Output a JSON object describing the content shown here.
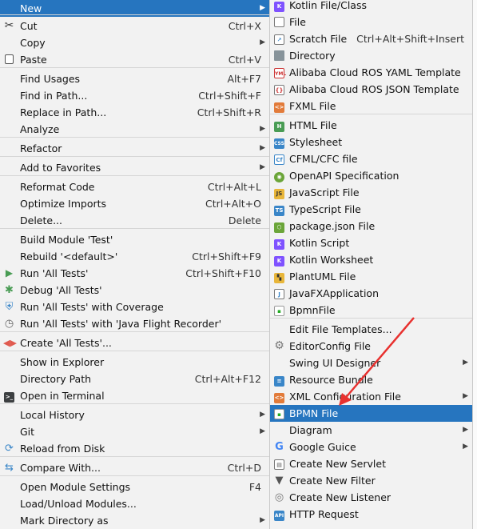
{
  "left_menu": {
    "items": [
      {
        "label": "New",
        "shortcut": "",
        "submenu": true,
        "icon": "",
        "selected": true
      },
      {
        "label": "Cut",
        "shortcut": "Ctrl+X",
        "submenu": false,
        "icon": "scissors-icon"
      },
      {
        "label": "Copy",
        "shortcut": "",
        "submenu": true,
        "icon": ""
      },
      {
        "label": "Paste",
        "shortcut": "Ctrl+V",
        "submenu": false,
        "icon": "clipboard-icon"
      },
      {
        "label": "Find Usages",
        "shortcut": "Alt+F7",
        "submenu": false,
        "icon": ""
      },
      {
        "label": "Find in Path...",
        "shortcut": "Ctrl+Shift+F",
        "submenu": false,
        "icon": ""
      },
      {
        "label": "Replace in Path...",
        "shortcut": "Ctrl+Shift+R",
        "submenu": false,
        "icon": ""
      },
      {
        "label": "Analyze",
        "shortcut": "",
        "submenu": true,
        "icon": ""
      },
      {
        "label": "Refactor",
        "shortcut": "",
        "submenu": true,
        "icon": ""
      },
      {
        "label": "Add to Favorites",
        "shortcut": "",
        "submenu": true,
        "icon": ""
      },
      {
        "label": "Reformat Code",
        "shortcut": "Ctrl+Alt+L",
        "submenu": false,
        "icon": ""
      },
      {
        "label": "Optimize Imports",
        "shortcut": "Ctrl+Alt+O",
        "submenu": false,
        "icon": ""
      },
      {
        "label": "Delete...",
        "shortcut": "Delete",
        "submenu": false,
        "icon": ""
      },
      {
        "label": "Build Module 'Test'",
        "shortcut": "",
        "submenu": false,
        "icon": ""
      },
      {
        "label": "Rebuild '<default>'",
        "shortcut": "Ctrl+Shift+F9",
        "submenu": false,
        "icon": ""
      },
      {
        "label": "Run 'All Tests'",
        "shortcut": "Ctrl+Shift+F10",
        "submenu": false,
        "icon": "run-icon"
      },
      {
        "label": "Debug 'All Tests'",
        "shortcut": "",
        "submenu": false,
        "icon": "debug-icon"
      },
      {
        "label": "Run 'All Tests' with Coverage",
        "shortcut": "",
        "submenu": false,
        "icon": "coverage-icon"
      },
      {
        "label": "Run 'All Tests' with 'Java Flight Recorder'",
        "shortcut": "",
        "submenu": false,
        "icon": "profiler-icon"
      },
      {
        "label": "Create 'All Tests'...",
        "shortcut": "",
        "submenu": false,
        "icon": "create-test-icon"
      },
      {
        "label": "Show in Explorer",
        "shortcut": "",
        "submenu": false,
        "icon": ""
      },
      {
        "label": "Directory Path",
        "shortcut": "Ctrl+Alt+F12",
        "submenu": false,
        "icon": ""
      },
      {
        "label": "Open in Terminal",
        "shortcut": "",
        "submenu": false,
        "icon": "terminal-icon"
      },
      {
        "label": "Local History",
        "shortcut": "",
        "submenu": true,
        "icon": ""
      },
      {
        "label": "Git",
        "shortcut": "",
        "submenu": true,
        "icon": ""
      },
      {
        "label": "Reload from Disk",
        "shortcut": "",
        "submenu": false,
        "icon": "reload-icon"
      },
      {
        "label": "Compare With...",
        "shortcut": "Ctrl+D",
        "submenu": false,
        "icon": "compare-icon"
      },
      {
        "label": "Open Module Settings",
        "shortcut": "F4",
        "submenu": false,
        "icon": ""
      },
      {
        "label": "Load/Unload Modules...",
        "shortcut": "",
        "submenu": false,
        "icon": ""
      },
      {
        "label": "Mark Directory as",
        "shortcut": "",
        "submenu": true,
        "icon": ""
      }
    ]
  },
  "new_submenu": {
    "items": [
      {
        "label": "Kotlin File/Class",
        "shortcut": "",
        "submenu": false,
        "icon": "kotlin-file-icon"
      },
      {
        "label": "File",
        "shortcut": "",
        "submenu": false,
        "icon": "file-icon"
      },
      {
        "label": "Scratch File",
        "shortcut": "Ctrl+Alt+Shift+Insert",
        "submenu": false,
        "icon": "scratch-file-icon"
      },
      {
        "label": "Directory",
        "shortcut": "",
        "submenu": false,
        "icon": "folder-icon"
      },
      {
        "label": "Alibaba Cloud ROS YAML Template",
        "shortcut": "",
        "submenu": false,
        "icon": "yaml-icon"
      },
      {
        "label": "Alibaba Cloud ROS JSON Template",
        "shortcut": "",
        "submenu": false,
        "icon": "json-template-icon"
      },
      {
        "label": "FXML File",
        "shortcut": "",
        "submenu": false,
        "icon": "fxml-file-icon"
      },
      {
        "label": "HTML File",
        "shortcut": "",
        "submenu": false,
        "icon": "html-file-icon"
      },
      {
        "label": "Stylesheet",
        "shortcut": "",
        "submenu": false,
        "icon": "css-file-icon"
      },
      {
        "label": "CFML/CFC file",
        "shortcut": "",
        "submenu": false,
        "icon": "cfml-file-icon"
      },
      {
        "label": "OpenAPI Specification",
        "shortcut": "",
        "submenu": false,
        "icon": "openapi-icon"
      },
      {
        "label": "JavaScript File",
        "shortcut": "",
        "submenu": false,
        "icon": "javascript-file-icon"
      },
      {
        "label": "TypeScript File",
        "shortcut": "",
        "submenu": false,
        "icon": "typescript-file-icon"
      },
      {
        "label": "package.json File",
        "shortcut": "",
        "submenu": false,
        "icon": "package-json-icon"
      },
      {
        "label": "Kotlin Script",
        "shortcut": "",
        "submenu": false,
        "icon": "kotlin-script-icon"
      },
      {
        "label": "Kotlin Worksheet",
        "shortcut": "",
        "submenu": false,
        "icon": "kotlin-worksheet-icon"
      },
      {
        "label": "PlantUML File",
        "shortcut": "",
        "submenu": false,
        "icon": "plantuml-icon"
      },
      {
        "label": "JavaFXApplication",
        "shortcut": "",
        "submenu": false,
        "icon": "javafx-icon"
      },
      {
        "label": "BpmnFile",
        "shortcut": "",
        "submenu": false,
        "icon": "bpmn-icon"
      },
      {
        "label": "Edit File Templates...",
        "shortcut": "",
        "submenu": false,
        "icon": ""
      },
      {
        "label": "EditorConfig File",
        "shortcut": "",
        "submenu": false,
        "icon": "editorconfig-icon"
      },
      {
        "label": "Swing UI Designer",
        "shortcut": "",
        "submenu": true,
        "icon": ""
      },
      {
        "label": "Resource Bundle",
        "shortcut": "",
        "submenu": false,
        "icon": "resource-bundle-icon"
      },
      {
        "label": "XML Configuration File",
        "shortcut": "",
        "submenu": true,
        "icon": "xml-file-icon"
      },
      {
        "label": "BPMN File",
        "shortcut": "",
        "submenu": false,
        "icon": "bpmn-icon",
        "selected": true
      },
      {
        "label": "Diagram",
        "shortcut": "",
        "submenu": true,
        "icon": ""
      },
      {
        "label": "Google Guice",
        "shortcut": "",
        "submenu": true,
        "icon": "google-icon"
      },
      {
        "label": "Create New Servlet",
        "shortcut": "",
        "submenu": false,
        "icon": "servlet-icon"
      },
      {
        "label": "Create New Filter",
        "shortcut": "",
        "submenu": false,
        "icon": "filter-icon"
      },
      {
        "label": "Create New Listener",
        "shortcut": "",
        "submenu": false,
        "icon": "listener-icon"
      },
      {
        "label": "HTTP Request",
        "shortcut": "",
        "submenu": false,
        "icon": "api-icon"
      }
    ]
  },
  "colors": {
    "menu_background": "#f2f2f2",
    "selection": "#2675bf",
    "annotation_arrow": "#e8312f"
  }
}
